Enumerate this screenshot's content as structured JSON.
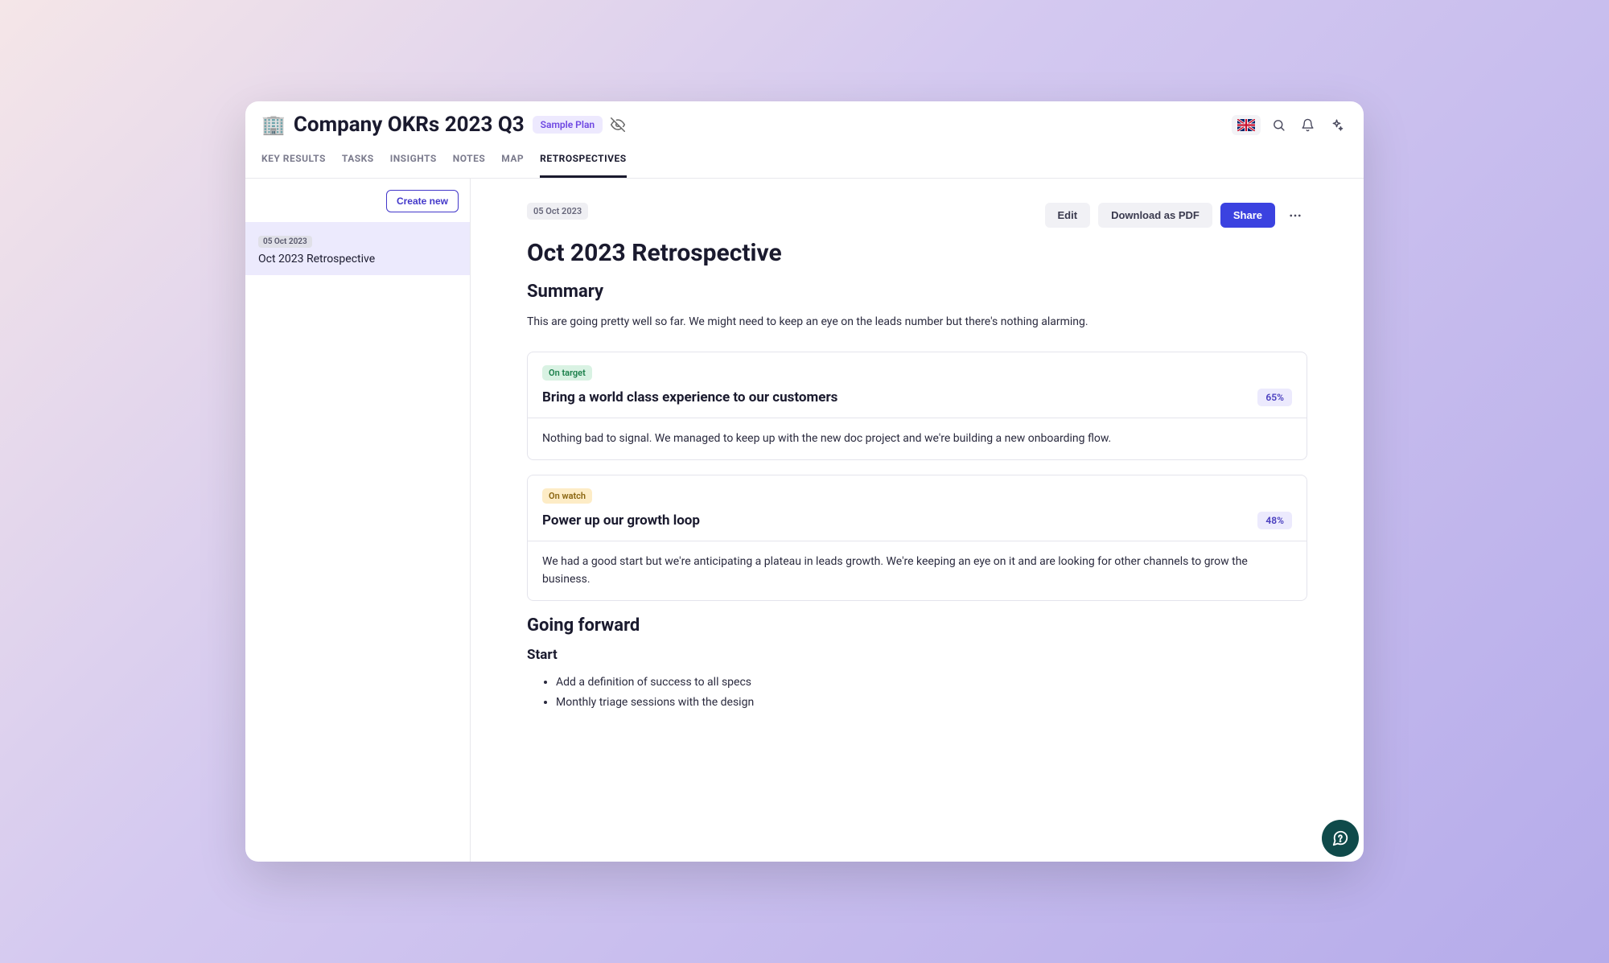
{
  "header": {
    "icon": "🏢",
    "title": "Company OKRs 2023 Q3",
    "plan_badge": "Sample Plan"
  },
  "tabs": [
    {
      "label": "KEY RESULTS",
      "active": false
    },
    {
      "label": "TASKS",
      "active": false
    },
    {
      "label": "INSIGHTS",
      "active": false
    },
    {
      "label": "NOTES",
      "active": false
    },
    {
      "label": "MAP",
      "active": false
    },
    {
      "label": "RETROSPECTIVES",
      "active": true
    }
  ],
  "sidebar": {
    "create_label": "Create new",
    "items": [
      {
        "date": "05 Oct 2023",
        "title": "Oct 2023 Retrospective"
      }
    ]
  },
  "content": {
    "date": "05 Oct 2023",
    "actions": {
      "edit": "Edit",
      "download": "Download as PDF",
      "share": "Share"
    },
    "title": "Oct 2023 Retrospective",
    "summary_heading": "Summary",
    "summary_text": "This are going pretty well so far. We might need to keep an eye on the leads number but there's nothing alarming.",
    "objectives": [
      {
        "status_label": "On target",
        "status_class": "status-on-target",
        "title": "Bring a world class experience to our customers",
        "pct": "65%",
        "body": "Nothing bad to signal. We managed to keep up with the new doc project and we're building a new onboarding flow."
      },
      {
        "status_label": "On watch",
        "status_class": "status-on-watch",
        "title": "Power up our growth loop",
        "pct": "48%",
        "body": "We had a good start but we're anticipating a plateau in leads growth. We're keeping an eye on it and are looking for other channels to grow the business."
      }
    ],
    "forward_heading": "Going forward",
    "start_heading": "Start",
    "start_items": [
      "Add a definition of success to all specs",
      "Monthly triage sessions with the design"
    ]
  }
}
